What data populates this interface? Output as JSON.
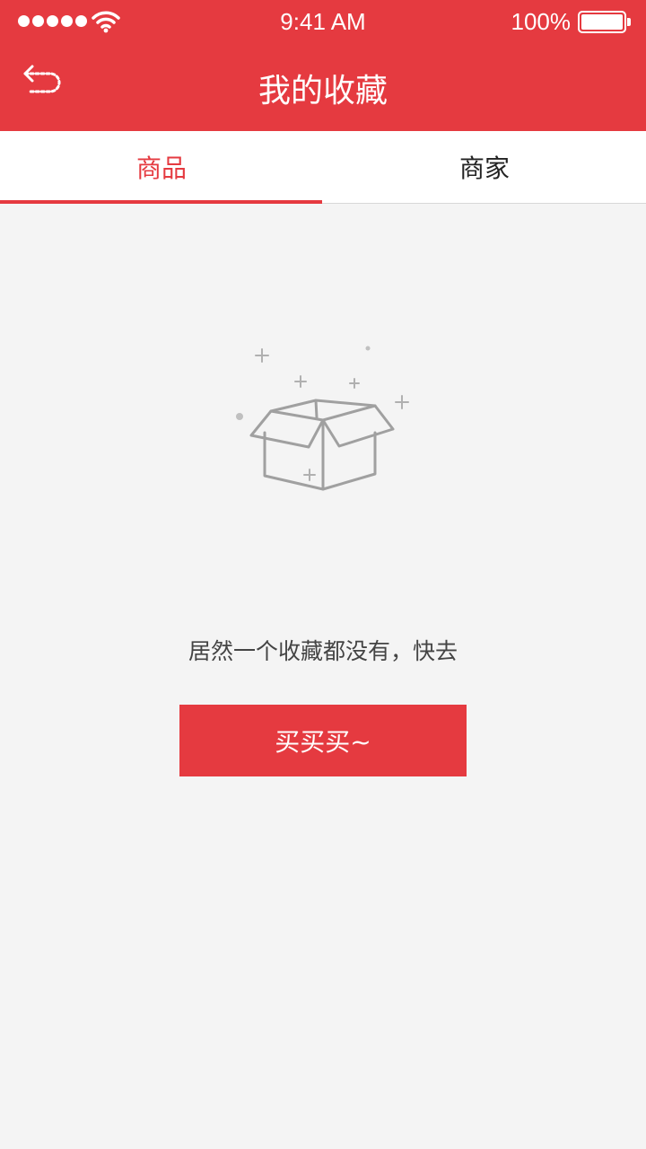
{
  "status_bar": {
    "time": "9:41 AM",
    "battery": "100%",
    "signal_icon": "signal-dots-icon",
    "wifi_icon": "wifi-icon"
  },
  "nav": {
    "title": "我的收藏",
    "back_icon": "back-arrow-icon"
  },
  "tabs": [
    {
      "label": "商品",
      "active": true
    },
    {
      "label": "商家",
      "active": false
    }
  ],
  "empty_state": {
    "icon": "empty-box-icon",
    "message": "居然一个收藏都没有，快去",
    "button_label": "买买买~"
  },
  "colors": {
    "primary": "#e53a40",
    "background": "#f4f4f4",
    "icon_gray": "#a0a0a0"
  }
}
